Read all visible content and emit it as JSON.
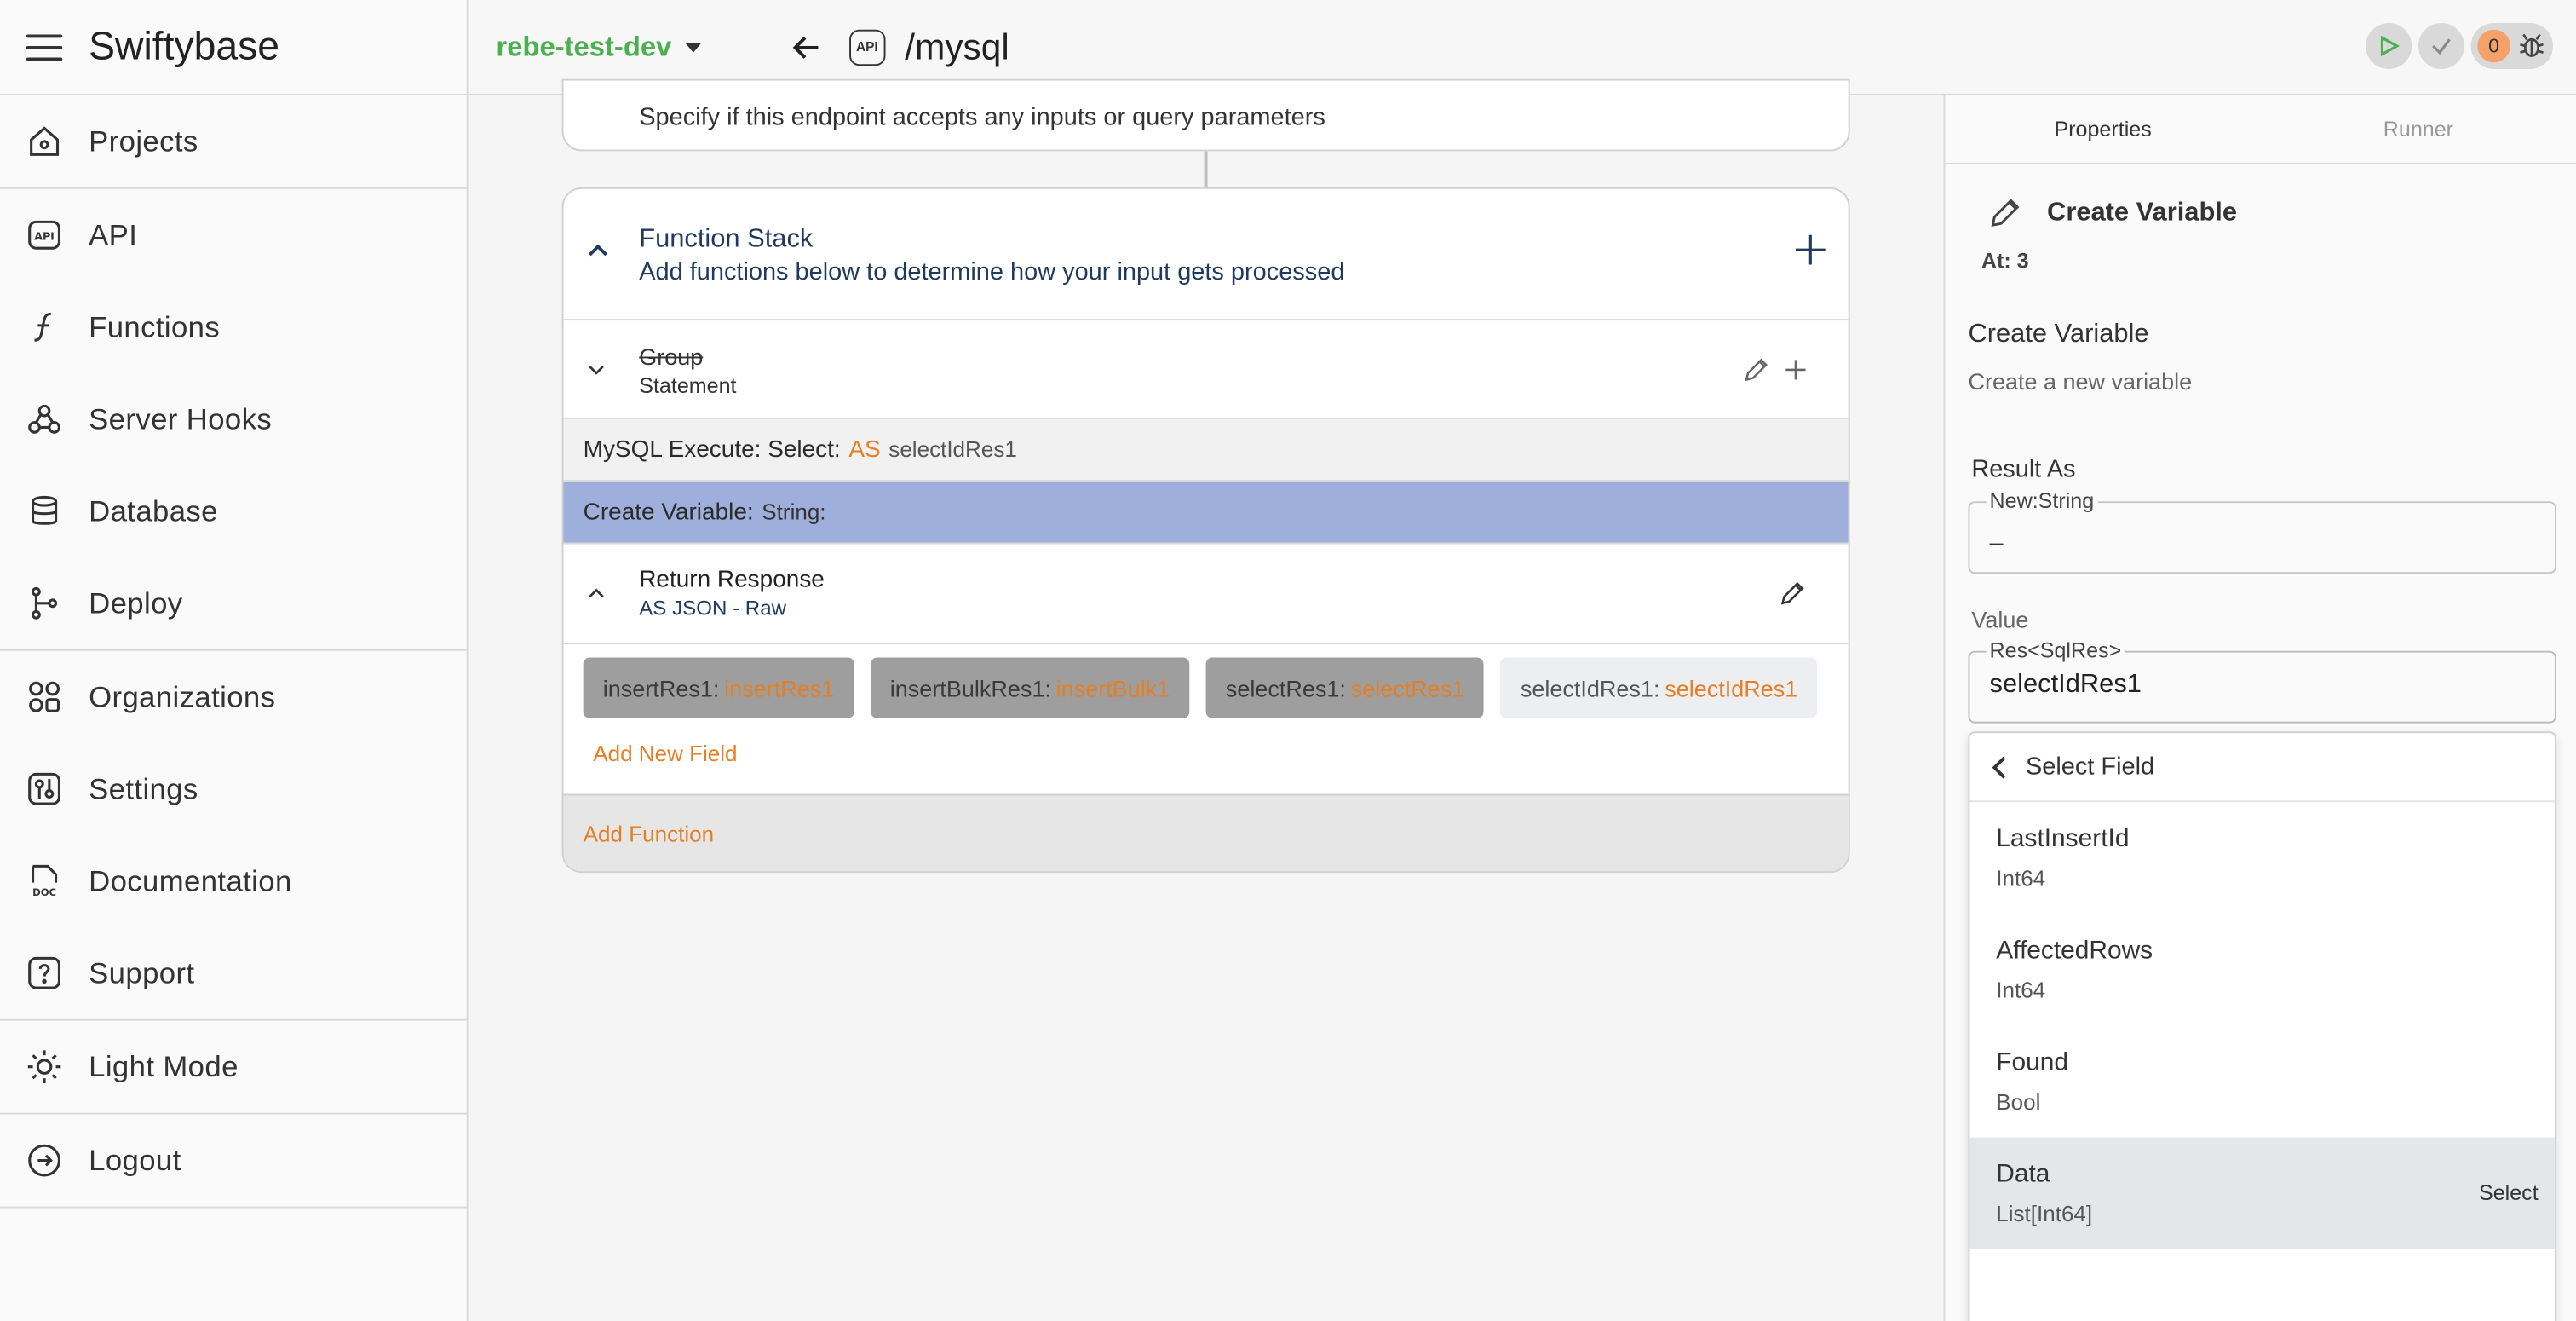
{
  "sidebar": {
    "brand": "Swiftybase",
    "groups": [
      [
        {
          "label": "Projects",
          "icon": "home-icon"
        }
      ],
      [
        {
          "label": "API",
          "icon": "api-icon"
        },
        {
          "label": "Functions",
          "icon": "function-icon"
        },
        {
          "label": "Server Hooks",
          "icon": "webhook-icon"
        },
        {
          "label": "Database",
          "icon": "database-icon"
        },
        {
          "label": "Deploy",
          "icon": "branch-icon"
        }
      ],
      [
        {
          "label": "Organizations",
          "icon": "organizations-icon"
        },
        {
          "label": "Settings",
          "icon": "settings-icon"
        },
        {
          "label": "Documentation",
          "icon": "doc-icon"
        },
        {
          "label": "Support",
          "icon": "help-icon"
        }
      ],
      [
        {
          "label": "Light Mode",
          "icon": "sun-icon"
        }
      ],
      [
        {
          "label": "Logout",
          "icon": "logout-icon"
        }
      ]
    ]
  },
  "header": {
    "project": "rebe-test-dev",
    "api_badge": "API",
    "path": "/mysql",
    "error_count": "0",
    "accent_green": "#4caf50"
  },
  "canvas": {
    "inputs_desc": "Specify if this endpoint accepts any inputs or query parameters",
    "stack_title": "Function Stack",
    "stack_desc": "Add functions below to determine how your input gets processed",
    "group_title": "Group",
    "group_sub": "Statement",
    "mysql_label": "MySQL Execute: Select:",
    "mysql_as": "AS",
    "mysql_var": "selectIdRes1",
    "create_label": "Create Variable:",
    "create_type": "String:",
    "response_title": "Return Response",
    "response_sub": "AS JSON - Raw",
    "chips": [
      {
        "key": "insertRes1:",
        "val": "insertRes1",
        "style": "dark"
      },
      {
        "key": "insertBulkRes1:",
        "val": "insertBulk1",
        "style": "dark"
      },
      {
        "key": "selectRes1:",
        "val": "selectRes1",
        "style": "dark"
      },
      {
        "key": "selectIdRes1:",
        "val": "selectIdRes1",
        "style": "light"
      }
    ],
    "add_field": "Add New Field",
    "add_function": "Add Function"
  },
  "panel": {
    "tabs": [
      "Properties",
      "Runner"
    ],
    "title": "Create Variable",
    "at": "At: 3",
    "cv_title": "Create Variable",
    "cv_desc": "Create a new variable",
    "result_label": "Result As",
    "result_legend": "New:String",
    "result_value": "–",
    "value_label": "Value",
    "value_legend": "Res<SqlRes>",
    "value_value": "selectIdRes1",
    "dropdown_title": "Select Field",
    "options": [
      {
        "name": "LastInsertId",
        "type": "Int64"
      },
      {
        "name": "AffectedRows",
        "type": "Int64"
      },
      {
        "name": "Found",
        "type": "Bool"
      },
      {
        "name": "Data",
        "type": "List[Int64]"
      }
    ],
    "select_label": "Select"
  }
}
